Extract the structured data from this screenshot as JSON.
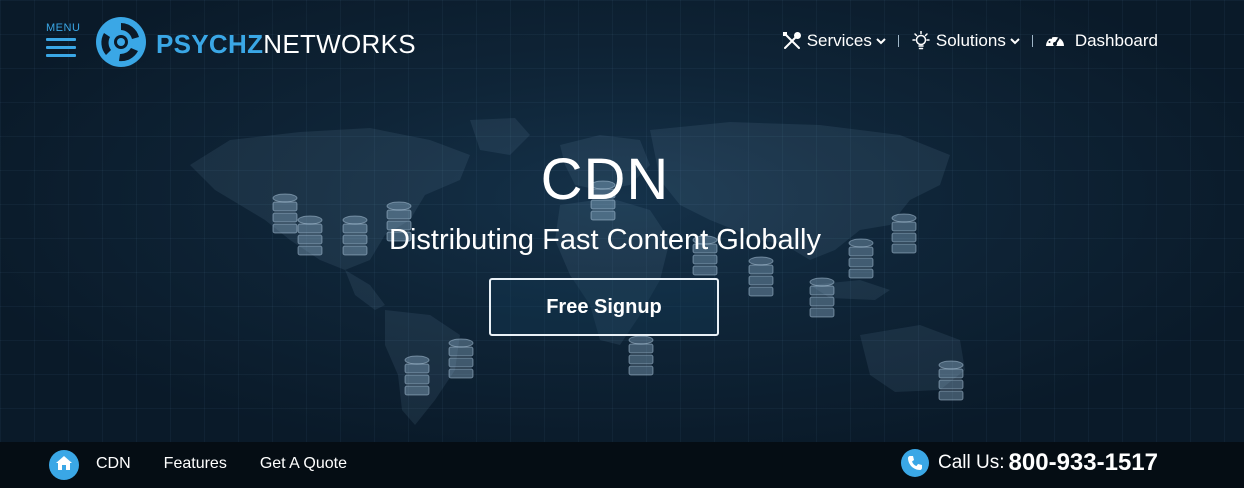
{
  "header": {
    "menu_label": "MENU",
    "logo_part1": "PSYCHZ",
    "logo_part2": "NETWORKS",
    "nav": [
      {
        "label": "Services",
        "icon": "tools-icon",
        "has_dropdown": true
      },
      {
        "label": "Solutions",
        "icon": "lightbulb-icon",
        "has_dropdown": true
      },
      {
        "label": "Dashboard",
        "icon": "speedometer-icon",
        "has_dropdown": false
      }
    ]
  },
  "hero": {
    "title": "CDN",
    "subtitle": "Distributing Fast Content Globally",
    "cta_label": "Free Signup"
  },
  "subnav": {
    "links": [
      "CDN",
      "Features",
      "Get A Quote"
    ],
    "call_label": "Call Us:",
    "phone": "800-933-1517"
  },
  "colors": {
    "accent": "#3aa7e6",
    "background": "#0c1a28",
    "bar": "#050d14"
  }
}
